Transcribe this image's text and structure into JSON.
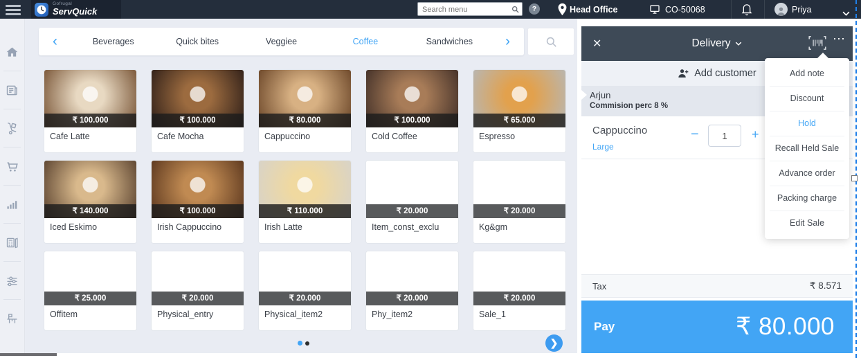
{
  "topbar": {
    "brand_small": "Gofrugal",
    "brand": "ServQuick",
    "search_placeholder": "Search menu",
    "help_label": "?",
    "location": "Head Office",
    "terminal": "CO-50068",
    "user": "Priya"
  },
  "sidebar": {
    "icons": [
      {
        "name": "home"
      },
      {
        "name": "orders"
      },
      {
        "name": "stock"
      },
      {
        "name": "cart"
      },
      {
        "name": "reports"
      },
      {
        "name": "register"
      },
      {
        "name": "settings"
      },
      {
        "name": "dine-table"
      }
    ]
  },
  "categories": {
    "items": [
      {
        "label": "Beverages",
        "selected": false
      },
      {
        "label": "Quick bites",
        "selected": false
      },
      {
        "label": "Veggiee",
        "selected": false
      },
      {
        "label": "Coffee",
        "selected": true
      },
      {
        "label": "Sandwiches",
        "selected": false
      }
    ]
  },
  "products": [
    {
      "name": "Cafe Latte",
      "price": "₹ 100.000",
      "photo": [
        "#e8d9c2",
        "#7d5a3c"
      ]
    },
    {
      "name": "Cafe Mocha",
      "price": "₹ 100.000",
      "photo": [
        "#9c6b3f",
        "#33221a"
      ]
    },
    {
      "name": "Cappuccino",
      "price": "₹ 80.000",
      "photo": [
        "#d8b183",
        "#6f4a2c"
      ]
    },
    {
      "name": "Cold Coffee",
      "price": "₹ 100.000",
      "photo": [
        "#a87c58",
        "#46332a"
      ]
    },
    {
      "name": "Espresso",
      "price": "₹ 65.000",
      "photo": [
        "#e2a14d",
        "#b9b6b0"
      ]
    },
    {
      "name": "Iced Eskimo",
      "price": "₹ 140.000",
      "photo": [
        "#d9b98c",
        "#5f4733"
      ]
    },
    {
      "name": "Irish Cappuccino",
      "price": "₹ 100.000",
      "photo": [
        "#c08a52",
        "#5f3a20"
      ]
    },
    {
      "name": "Irish Latte",
      "price": "₹ 110.000",
      "photo": [
        "#f0d9a0",
        "#d8d3c8"
      ]
    },
    {
      "name": "Item_const_exclu",
      "price": "₹ 20.000",
      "photo": null
    },
    {
      "name": "Kg&gm",
      "price": "₹ 20.000",
      "photo": null
    },
    {
      "name": "Offitem",
      "price": "₹ 25.000",
      "photo": null
    },
    {
      "name": "Physical_entry",
      "price": "₹ 20.000",
      "photo": null
    },
    {
      "name": "Physical_item2",
      "price": "₹ 20.000",
      "photo": null
    },
    {
      "name": "Phy_item2",
      "price": "₹ 20.000",
      "photo": null
    },
    {
      "name": "Sale_1",
      "price": "₹ 20.000",
      "photo": null
    }
  ],
  "pagination": {
    "dots": [
      {
        "active": true
      },
      {
        "active": false
      }
    ]
  },
  "cart": {
    "mode": "Delivery",
    "add_customer_label": "Add customer",
    "customer_name": "Arjun",
    "customer_note": "Commision perc 8 %",
    "item": {
      "name": "Cappuccino",
      "variant": "Large",
      "qty": "1",
      "minus": "−",
      "plus": "+"
    },
    "tax_label": "Tax",
    "tax_value": "₹ 8.571",
    "pay_label": "Pay",
    "pay_value": "₹ 80.000"
  },
  "context_menu": {
    "items": [
      {
        "label": "Add note",
        "active": false
      },
      {
        "label": "Discount",
        "active": false
      },
      {
        "label": "Hold",
        "active": true
      },
      {
        "label": "Recall Held Sale",
        "active": false
      },
      {
        "label": "Advance order",
        "active": false
      },
      {
        "label": "Packing charge",
        "active": false
      },
      {
        "label": "Edit Sale",
        "active": false
      }
    ]
  },
  "colors": {
    "accent": "#42a5f5",
    "topbar": "#242e3c",
    "panel_header": "#3e4a57",
    "pay_button": "#42a5f5"
  }
}
